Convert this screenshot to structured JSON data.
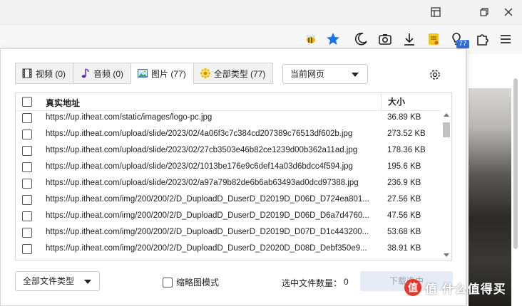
{
  "colors": {
    "accent": "#2f6fd6",
    "star": "#1a73e8",
    "badge": "#2f6fd6",
    "download_disabled_bg": "#e6ecf5"
  },
  "browser": {
    "window_controls": [
      "sidebar-icon",
      "restore-icon",
      "close-icon"
    ],
    "toolbar_icons": [
      "bee-extension-icon",
      "star-icon",
      "moon-icon",
      "camera-icon",
      "download-icon",
      "notes-extension-icon",
      "media-sniffer-icon",
      "puzzle-icon",
      "menu-icon"
    ],
    "extension_badge": "77"
  },
  "tabs": [
    {
      "label": "视频 (0)",
      "icon": "film-icon",
      "active": false
    },
    {
      "label": "音频 (0)",
      "icon": "music-note-icon",
      "active": false
    },
    {
      "label": "图片 (77)",
      "icon": "picture-icon",
      "active": true
    },
    {
      "label": "全部类型 (77)",
      "icon": "puzzle-piece-icon",
      "active": false
    }
  ],
  "scope_select": {
    "value": "当前网页"
  },
  "table": {
    "headers": {
      "url": "真实地址",
      "size": "大小"
    },
    "rows": [
      {
        "url": "https://up.itheat.com/static/images/logo-pc.jpg",
        "size": "36.89 KB"
      },
      {
        "url": "https://up.itheat.com/upload/slide/2023/02/4a06f3c7c384cd207389c76513df602b.jpg",
        "size": "273.52 KB"
      },
      {
        "url": "https://up.itheat.com/upload/slide/2023/02/27cb3503e46b82ce1239d00b362a11ad.jpg",
        "size": "178.36 KB"
      },
      {
        "url": "https://up.itheat.com/upload/slide/2023/02/1013be176e9c6def14a03d6bdcc4f594.jpg",
        "size": "195.6 KB"
      },
      {
        "url": "https://up.itheat.com/upload/slide/2023/02/a97a79b82de6b6ab63493ad0dcd97388.jpg",
        "size": "236.9 KB"
      },
      {
        "url": "https://up.itheat.com/img/200/200/2/D_DuploadD_DuserD_D2019D_D06D_D724ea801...",
        "size": "27.56 KB"
      },
      {
        "url": "https://up.itheat.com/img/200/200/2/D_DuploadD_DuserD_D2019D_D06D_D6a7d4760...",
        "size": "47.56 KB"
      },
      {
        "url": "https://up.itheat.com/img/200/200/2/D_DuploadD_DuserD_D2019D_D07D_D1c443200...",
        "size": "53.68 KB"
      },
      {
        "url": "https://up.itheat.com/img/200/200/2/D_DuploadD_DuserD_D2020D_D08D_Debf350e9...",
        "size": "38.91 KB"
      }
    ]
  },
  "footer": {
    "filetype_select": "全部文件类型",
    "thumbnail_mode": "缩略图模式",
    "selected_count_label": "选中文件数量：",
    "selected_count": "0",
    "download_button": "下载选中"
  },
  "watermark": {
    "text": "值 什么值得买"
  }
}
